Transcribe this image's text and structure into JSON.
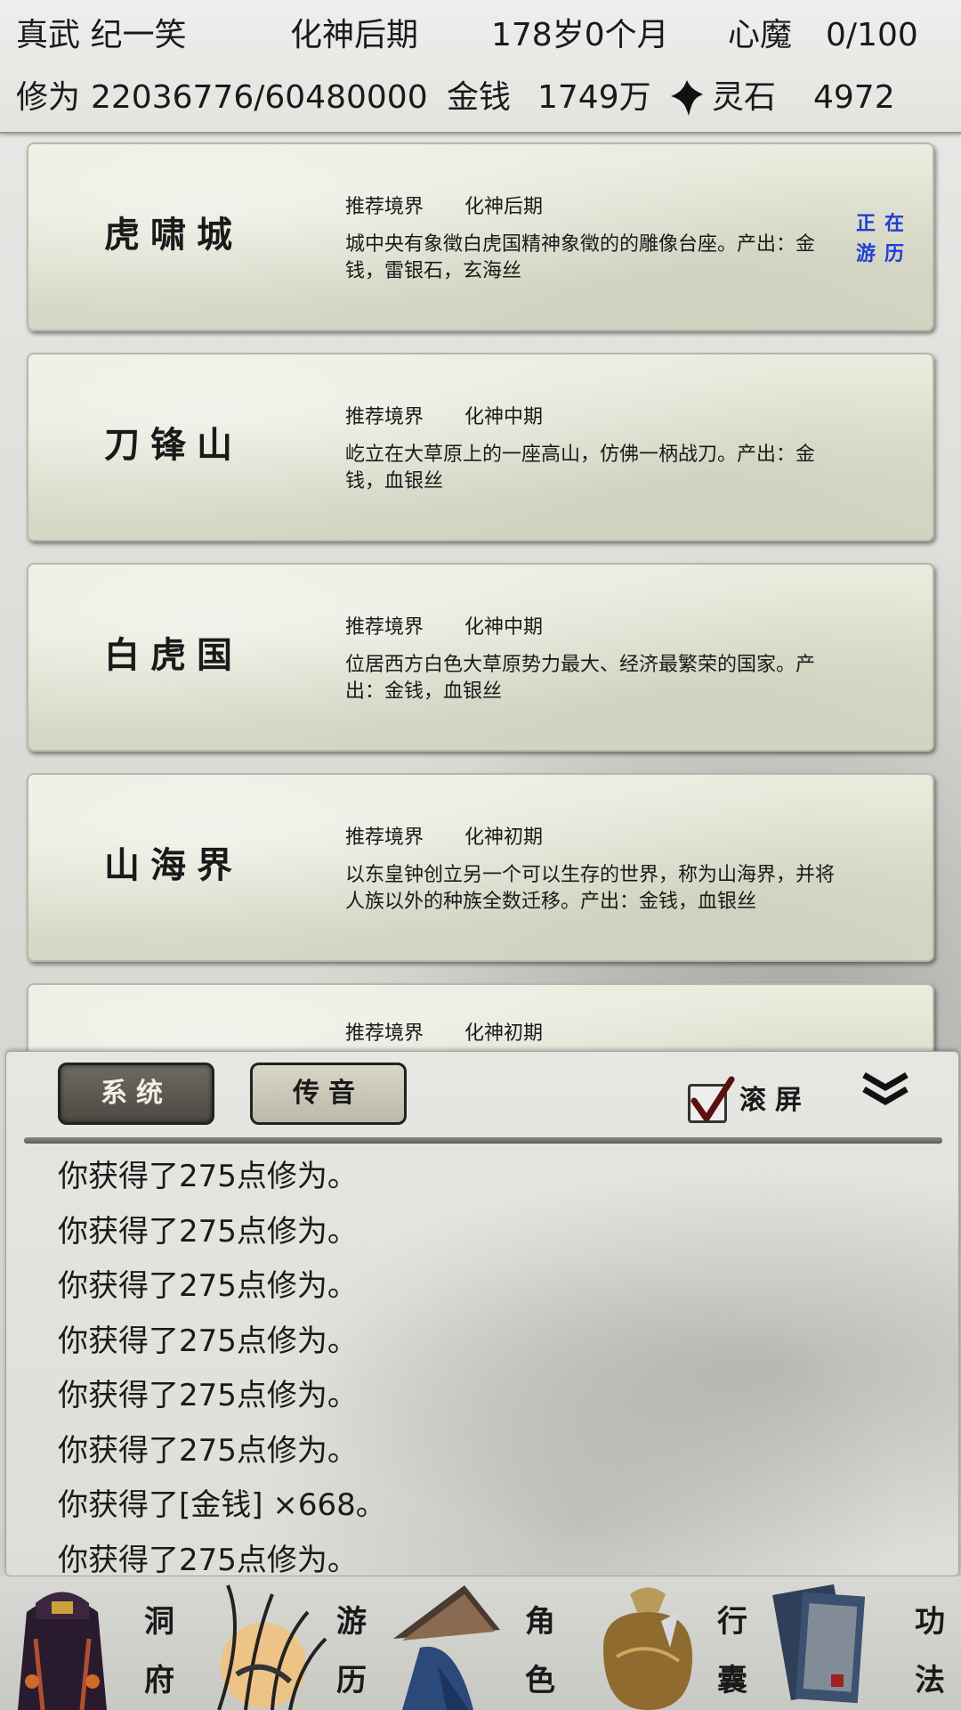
{
  "status": {
    "player": "真武 纪一笑",
    "realm": "化神后期",
    "age": "178岁0个月",
    "heart_demon_label": "心魔",
    "heart_demon_value": "0/100",
    "cultivation_label": "修为",
    "cultivation_value": "22036776/60480000",
    "money_label": "金钱",
    "money_value": "1749万",
    "spirit_stone_label": "灵石",
    "spirit_stone_value": "4972"
  },
  "locations": [
    {
      "name": "虎啸城",
      "rec_label": "推荐境界",
      "rec_level": "化神后期",
      "desc": "城中央有象徵白虎国精神象徵的的雕像台座。产出：金钱，雷银石，玄海丝",
      "status": "正在游历"
    },
    {
      "name": "刀锋山",
      "rec_label": "推荐境界",
      "rec_level": "化神中期",
      "desc": "屹立在大草原上的一座高山，仿佛一柄战刀。产出：金钱，血银丝",
      "status": ""
    },
    {
      "name": "白虎国",
      "rec_label": "推荐境界",
      "rec_level": "化神中期",
      "desc": "位居西方白色大草原势力最大、经济最繁荣的国家。产出：金钱，血银丝",
      "status": ""
    },
    {
      "name": "山海界",
      "rec_label": "推荐境界",
      "rec_level": "化神初期",
      "desc": "以东皇钟创立另一个可以生存的世界，称为山海界，并将人族以外的种族全数迁移。产出：金钱，血银丝",
      "status": ""
    },
    {
      "name": "",
      "rec_label": "推荐境界",
      "rec_level": "化神初期",
      "desc": "",
      "status": ""
    }
  ],
  "log": {
    "tab_system": "系统",
    "tab_voice": "传音",
    "scroll_label": "滚屏",
    "scroll_checked": true,
    "lines": [
      "你获得了275点修为。",
      "你获得了275点修为。",
      "你获得了275点修为。",
      "你获得了275点修为。",
      "你获得了275点修为。",
      "你获得了275点修为。",
      "你获得了[金钱] ×668。",
      "你获得了275点修为。"
    ]
  },
  "nav": [
    {
      "icon": "cave-abode-icon",
      "label_top": "洞",
      "label_bottom": "府"
    },
    {
      "icon": "travel-icon",
      "label_top": "游",
      "label_bottom": "历"
    },
    {
      "icon": "character-icon",
      "label_top": "角",
      "label_bottom": "色"
    },
    {
      "icon": "bag-icon",
      "label_top": "行",
      "label_bottom": "囊"
    },
    {
      "icon": "skills-icon",
      "label_top": "功",
      "label_bottom": "法"
    }
  ],
  "colors": {
    "traveling_status": "#1f3fd6",
    "tab_active_bg": "#4d4943",
    "tab_inactive_bg": "#bdb9a8"
  }
}
